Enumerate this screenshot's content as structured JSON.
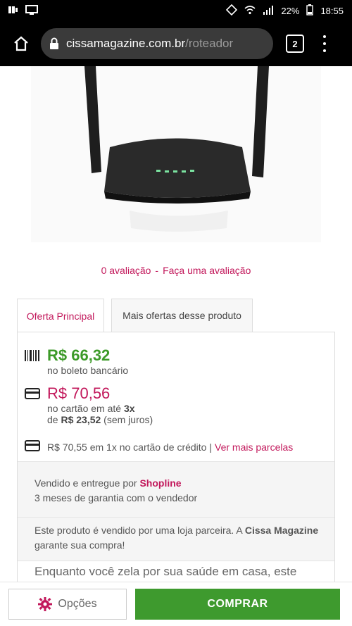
{
  "status_bar": {
    "battery": "22%",
    "time": "18:55"
  },
  "browser": {
    "url_domain": "cissamagazine.com.br",
    "url_path": "/roteador",
    "tab_count": "2"
  },
  "reviews": {
    "count_text": "0 avaliação",
    "separator": "-",
    "cta": "Faça uma avaliação"
  },
  "tabs": [
    {
      "label": "Oferta Principal",
      "active": true
    },
    {
      "label": "Mais ofertas desse produto",
      "active": false
    }
  ],
  "offer": {
    "boleto_price": "R$ 66,32",
    "boleto_label": "no boleto bancário",
    "card_price": "R$ 70,56",
    "card_installments_prefix": "no cartão em até ",
    "card_installments_count": "3x",
    "card_installments_de": "de ",
    "card_installment_value": "R$ 23,52",
    "card_installments_suffix": " (sem juros)",
    "one_time_text": "R$ 70,55 em 1x no cartão de crédito |",
    "more_installments_link": "Ver mais parcelas"
  },
  "seller": {
    "sold_by_prefix": "Vendido e entregue por ",
    "seller_name": "Shopline",
    "warranty": "3 meses de garantia com o vendedor"
  },
  "partner_notice": {
    "text_before": "Este produto é vendido por uma loja parceira. A ",
    "brand": "Cissa Magazine",
    "text_after": " garante sua compra!"
  },
  "promo_text": "Enquanto você zela por sua saúde em casa, este",
  "actions": {
    "options_label": "Opções",
    "buy_label": "COMPRAR"
  },
  "colors": {
    "accent": "#c2185b",
    "price_green": "#3c9a28",
    "buy_button": "#3e9a2e"
  }
}
